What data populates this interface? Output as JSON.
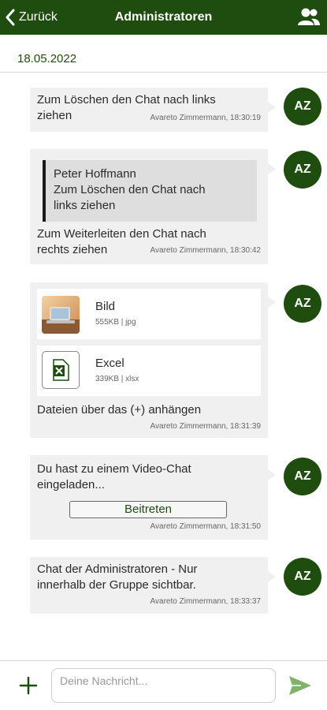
{
  "header": {
    "back_label": "Zurück",
    "title": "Administratoren",
    "accent": "#1f4d0f"
  },
  "date": "18.05.2022",
  "messages": [
    {
      "text": "Zum Löschen den Chat nach links ziehen",
      "line1": "Zum Löschen den Chat nach links",
      "line2": "ziehen",
      "sender_time": "Avareto Zimmermann, 18:30:19",
      "avatar": "AZ"
    },
    {
      "quote_author": "Peter Hoffmann",
      "quote_line1": "Zum Löschen den Chat nach",
      "quote_line2": "links ziehen",
      "line1": "Zum Weiterleiten den Chat nach",
      "line2": "rechts ziehen",
      "sender_time": "Avareto Zimmermann, 18:30:42",
      "avatar": "AZ"
    },
    {
      "attachments": [
        {
          "name": "Bild",
          "info": "555KB | jpg",
          "icon": "image-thumbnail"
        },
        {
          "name": "Excel",
          "info": "339KB | xlsx",
          "icon": "excel-file-icon"
        }
      ],
      "line1": "Dateien über das (+) anhängen",
      "sender_time": "Avareto Zimmermann, 18:31:39",
      "avatar": "AZ"
    },
    {
      "line1": "Du hast zu einem Video-Chat",
      "line2": "eingeladen...",
      "button_label": "Beitreten",
      "sender_time": "Avareto Zimmermann, 18:31:50",
      "avatar": "AZ"
    },
    {
      "line1": "Chat der Administratoren - Nur",
      "line2": "innerhalb der Gruppe sichtbar.",
      "sender_time": "Avareto Zimmermann, 18:33:37",
      "avatar": "AZ"
    }
  ],
  "composer": {
    "placeholder": "Deine Nachricht...",
    "value": ""
  },
  "icons": {
    "back": "chevron-left-icon",
    "members": "group-icon",
    "add": "plus-icon",
    "send": "send-icon"
  }
}
